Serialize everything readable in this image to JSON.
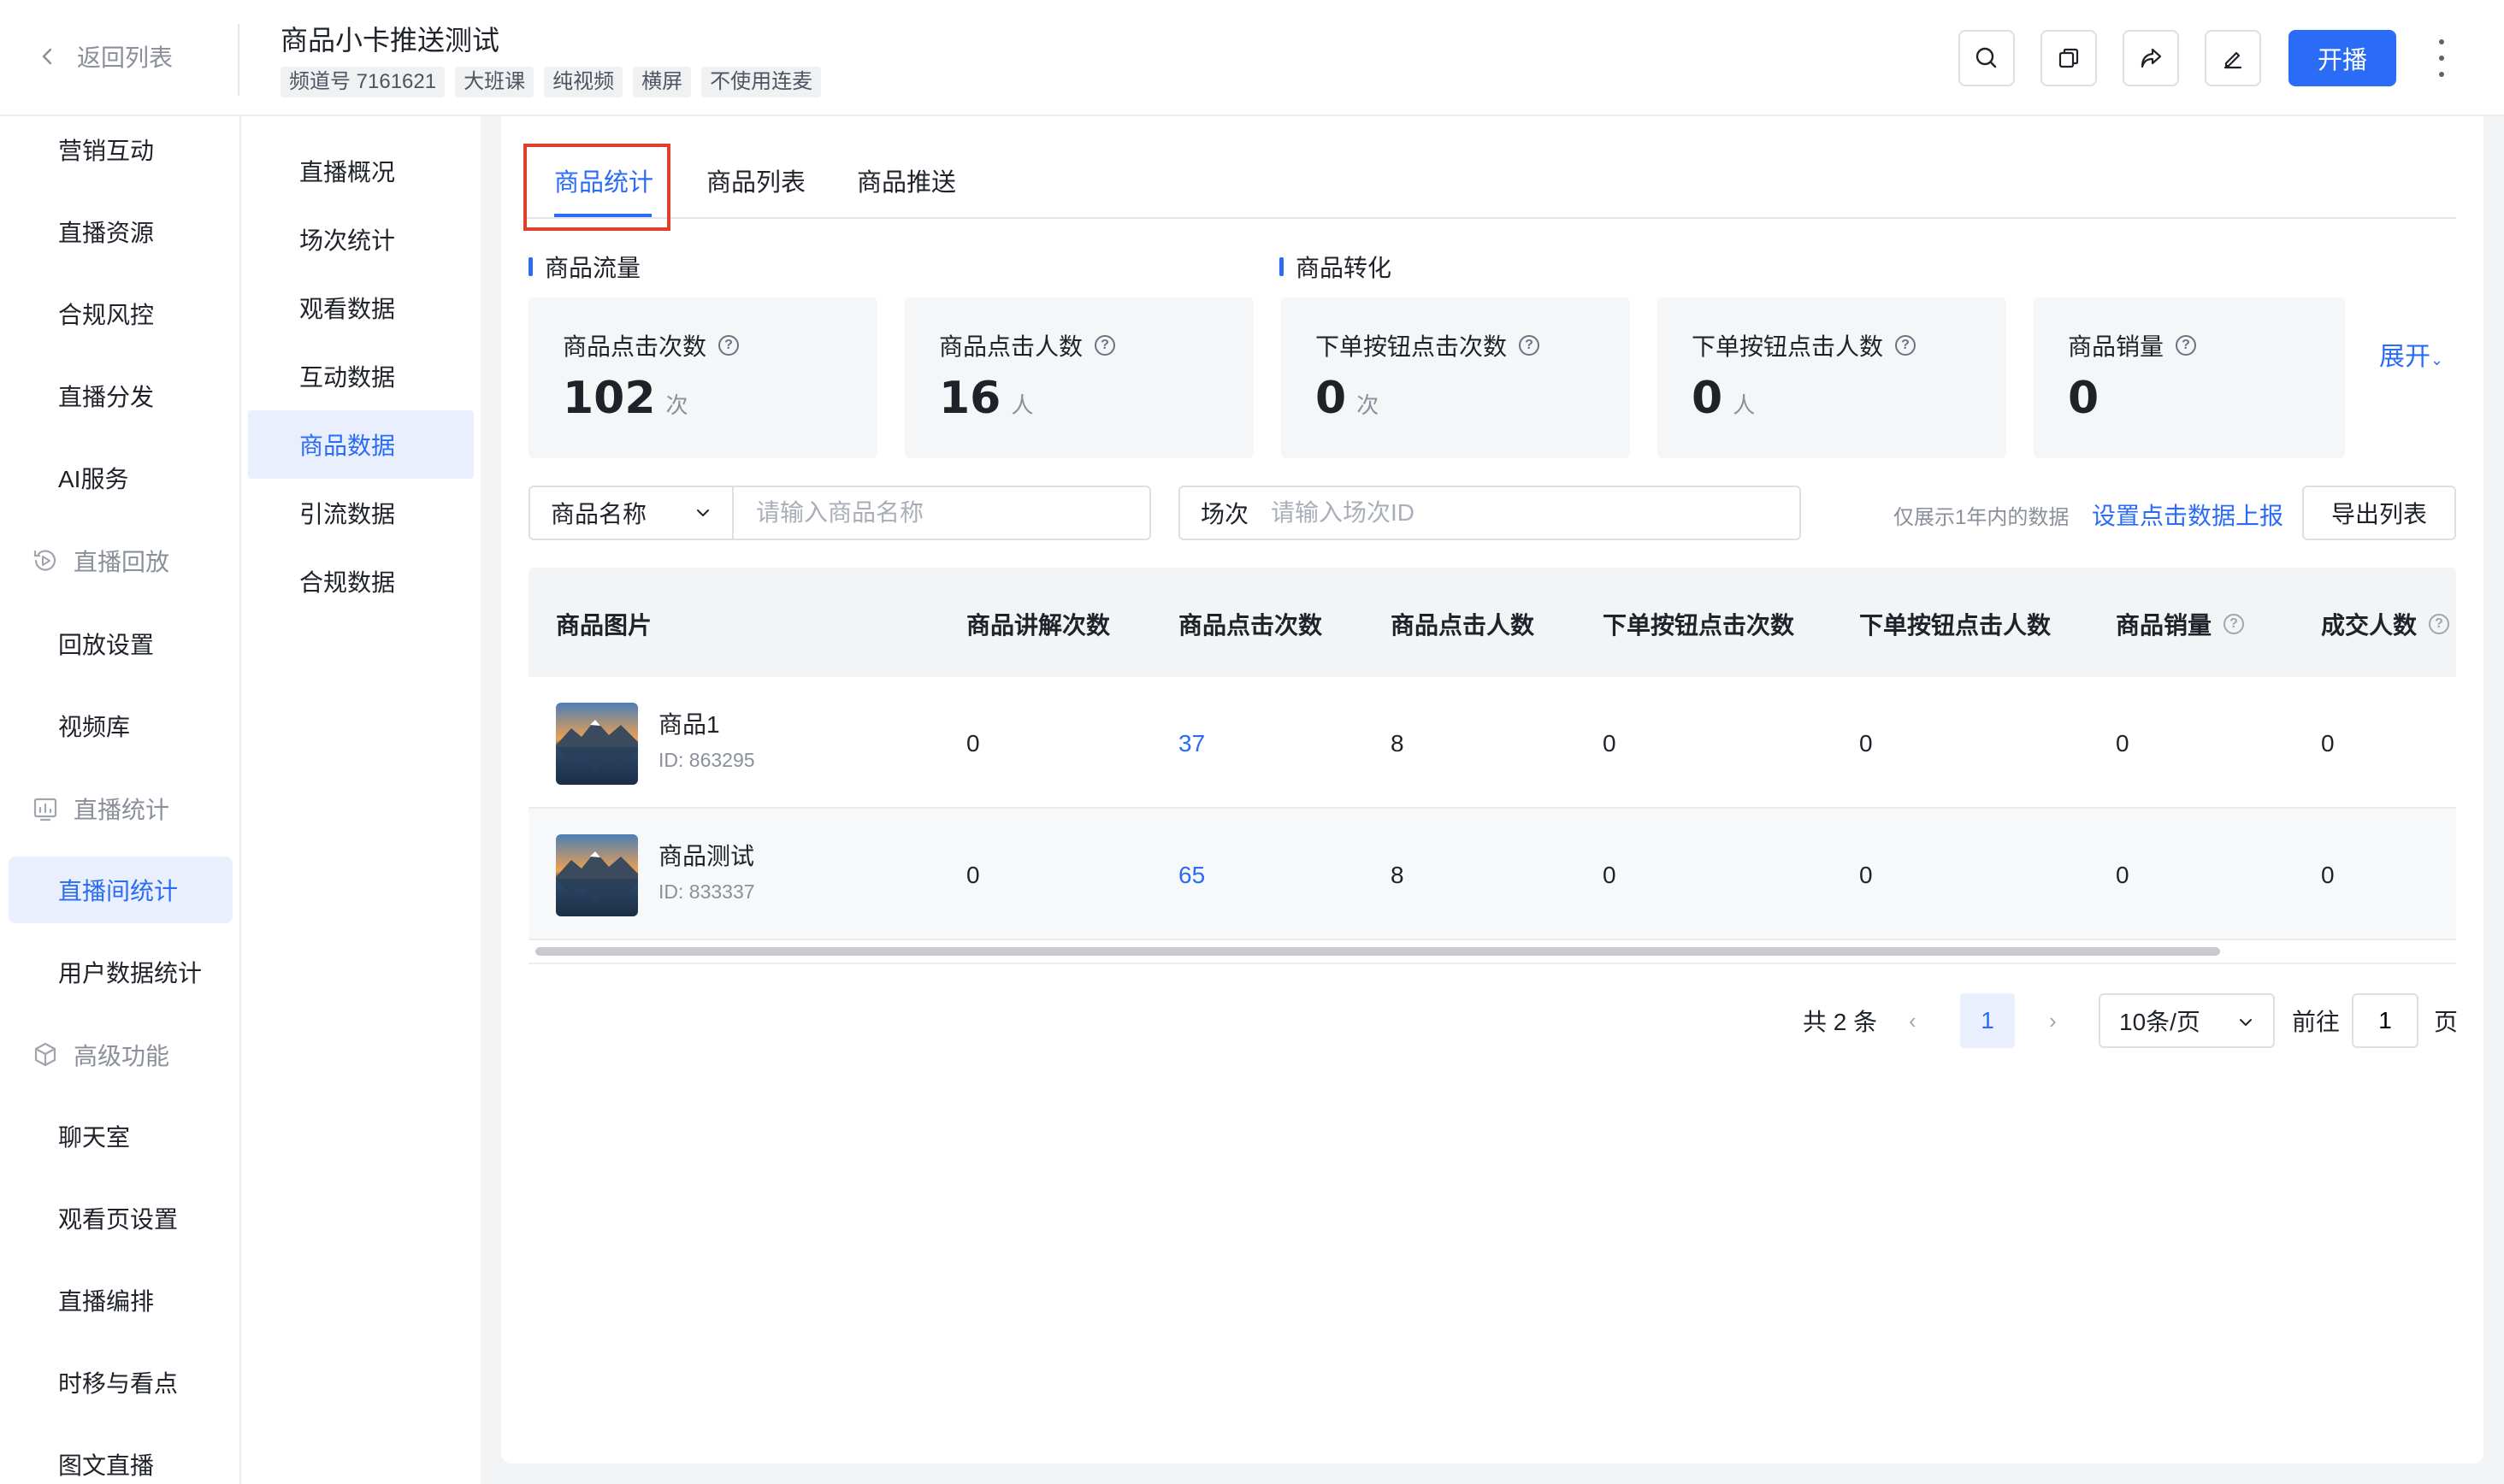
{
  "header": {
    "back_label": "返回列表",
    "title": "商品小卡推送测试",
    "tags": [
      "频道号 7161621",
      "大班课",
      "纯视频",
      "横屏",
      "不使用连麦"
    ],
    "actions": [
      "search-icon",
      "copy-icon",
      "share-icon",
      "edit-icon"
    ],
    "live_label": "开播"
  },
  "sidebar": {
    "items": [
      {
        "label": "营销互动"
      },
      {
        "label": "直播资源"
      },
      {
        "label": "合规风控"
      },
      {
        "label": "直播分发"
      },
      {
        "label": "AI服务"
      }
    ],
    "group_playback": "直播回放",
    "playback_items": [
      {
        "label": "回放设置"
      },
      {
        "label": "视频库"
      }
    ],
    "group_stats": "直播统计",
    "stats_items": [
      {
        "label": "直播间统计"
      },
      {
        "label": "用户数据统计"
      }
    ],
    "group_advanced": "高级功能",
    "advanced_items": [
      {
        "label": "聊天室"
      },
      {
        "label": "观看页设置"
      },
      {
        "label": "直播编排"
      },
      {
        "label": "时移与看点"
      },
      {
        "label": "图文直播"
      }
    ]
  },
  "subnav": {
    "items": [
      {
        "label": "直播概况"
      },
      {
        "label": "场次统计"
      },
      {
        "label": "观看数据"
      },
      {
        "label": "互动数据"
      },
      {
        "label": "商品数据"
      },
      {
        "label": "引流数据"
      },
      {
        "label": "合规数据"
      }
    ]
  },
  "tabs": [
    {
      "label": "商品统计"
    },
    {
      "label": "商品列表"
    },
    {
      "label": "商品推送"
    }
  ],
  "sections": {
    "traffic": "商品流量",
    "conversion": "商品转化"
  },
  "stats": [
    {
      "label": "商品点击次数",
      "value": "102",
      "unit": "次"
    },
    {
      "label": "商品点击人数",
      "value": "16",
      "unit": "人"
    },
    {
      "label": "下单按钮点击次数",
      "value": "0",
      "unit": "次"
    },
    {
      "label": "下单按钮点击人数",
      "value": "0",
      "unit": "人"
    },
    {
      "label": "商品销量",
      "value": "0",
      "unit": ""
    }
  ],
  "expand_label": "展开",
  "filters": {
    "select_label": "商品名称",
    "name_placeholder": "请输入商品名称",
    "session_label": "场次",
    "session_placeholder": "请输入场次ID",
    "hint": "仅展示1年内的数据",
    "report_link": "设置点击数据上报",
    "export_label": "导出列表"
  },
  "table": {
    "columns": [
      "商品图片",
      "商品讲解次数",
      "商品点击次数",
      "商品点击人数",
      "下单按钮点击次数",
      "下单按钮点击人数",
      "商品销量",
      "成交人数"
    ],
    "rows": [
      {
        "name": "商品1",
        "id": "ID: 863295",
        "cells": [
          "0",
          "37",
          "8",
          "0",
          "0",
          "0",
          "0"
        ]
      },
      {
        "name": "商品测试",
        "id": "ID: 833337",
        "cells": [
          "0",
          "65",
          "8",
          "0",
          "0",
          "0",
          "0"
        ]
      }
    ]
  },
  "pagination": {
    "total": "共 2 条",
    "prev": "‹",
    "next": "›",
    "current": "1",
    "page_size": "10条/页",
    "goto_label": "前往",
    "goto_value": "1",
    "page_word": "页"
  },
  "colors": {
    "accent": "#2b6cf6",
    "highlight": "#e0402b"
  }
}
